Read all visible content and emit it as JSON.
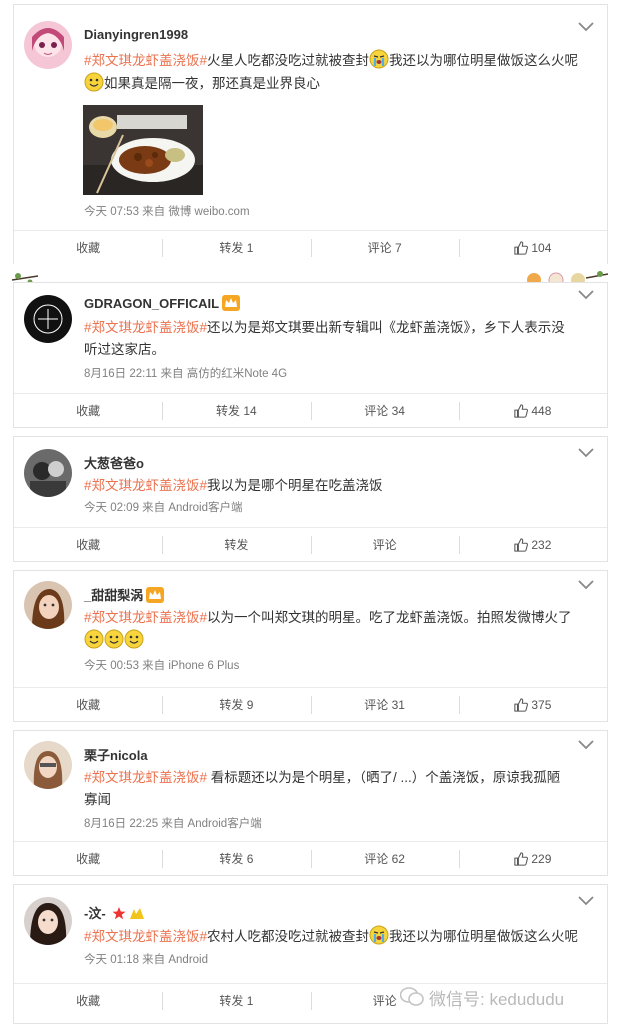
{
  "posts": [
    {
      "username": "Dianyingren1998",
      "tag": "#郑文琪龙虾盖浇饭#",
      "text_a": "火星人吃都没吃过就被查封",
      "text_b": "我还以为哪位明星做饭这么火呢",
      "text_c": "如果真是隔一夜，那还真是业界良心",
      "meta": "今天 07:53 来自 微博 weibo.com",
      "actions": {
        "fav": "收藏",
        "repost": "转发 1",
        "comment": "评论 7",
        "like": "104"
      }
    },
    {
      "username": "GDRAGON_OFFICAIL",
      "tag": "#郑文琪龙虾盖浇饭#",
      "text_a": "还以为是郑文琪要出新专辑叫《龙虾盖浇饭》，乡下人表示没",
      "text_b": "听过这家店。",
      "meta": "8月16日 22:11 来自 高仿的红米Note 4G",
      "actions": {
        "fav": "收藏",
        "repost": "转发 14",
        "comment": "评论 34",
        "like": "448"
      }
    },
    {
      "username": "大葱爸爸o",
      "tag": "#郑文琪龙虾盖浇饭#",
      "text_a": "我以为是哪个明星在吃盖浇饭",
      "meta": "今天 02:09 来自 Android客户端",
      "actions": {
        "fav": "收藏",
        "repost": "转发",
        "comment": "评论",
        "like": "232"
      }
    },
    {
      "username": "_甜甜梨涡",
      "tag": "#郑文琪龙虾盖浇饭#",
      "text_a": "以为一个叫郑文琪的明星。吃了龙虾盖浇饭。拍照发微博火了",
      "meta": "今天 00:53 来自 iPhone 6 Plus",
      "actions": {
        "fav": "收藏",
        "repost": "转发 9",
        "comment": "评论 31",
        "like": "375"
      }
    },
    {
      "username": "栗子nicola",
      "tag": "#郑文琪龙虾盖浇饭#",
      "text_a": " 看标题还以为是个明星，（晒了/ ...）个盖浇饭，原谅我孤陋",
      "text_b": "寡闻",
      "meta": "8月16日 22:25 来自 Android客户端",
      "actions": {
        "fav": "收藏",
        "repost": "转发 6",
        "comment": "评论 62",
        "like": "229"
      }
    },
    {
      "username": "-汶-",
      "tag": "#郑文琪龙虾盖浇饭#",
      "text_a": "农村人吃都没吃过就被查封",
      "text_b": "我还以为哪位明星做饭这么火呢",
      "meta": "今天 01:18 来自 Android",
      "actions": {
        "fav": "收藏",
        "repost": "转发 1",
        "comment": "评论",
        "like": ""
      }
    }
  ],
  "watermark": "微信号: kedududu",
  "colors": {
    "tag": "#eb7350",
    "meta": "#808080",
    "border": "#e3e3e3"
  }
}
